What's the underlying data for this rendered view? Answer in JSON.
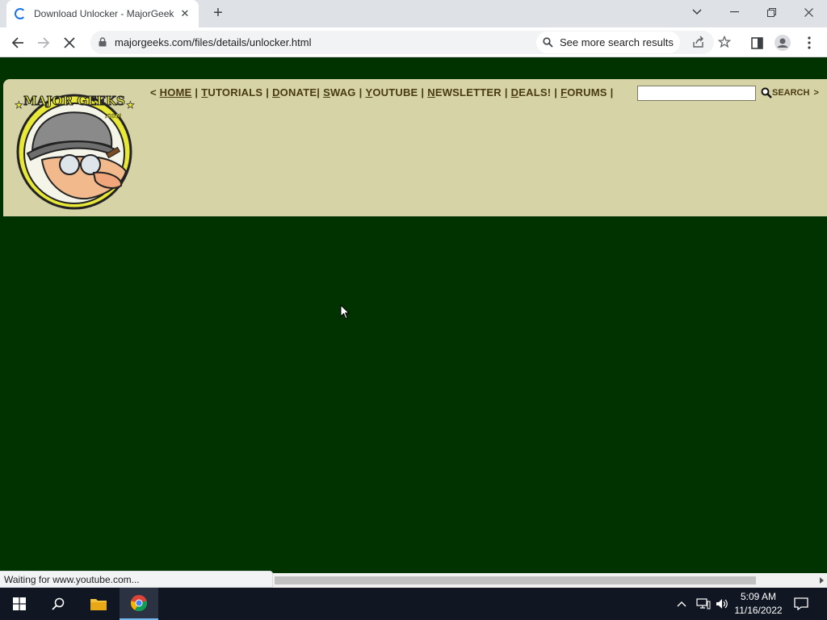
{
  "browser": {
    "tab_title": "Download Unlocker - MajorGeek",
    "tab_close": "✕",
    "new_tab": "+",
    "url": "majorgeeks.com/files/details/unlocker.html",
    "search_suggestion": "See more search results",
    "status_text": "Waiting for www.youtube.com..."
  },
  "site": {
    "logo_text": "MAJOR GEEKS",
    "logo_sub": ".COM",
    "nav_open": "<",
    "nav_close": ">",
    "nav_items": [
      {
        "first": "H",
        "rest": "OME"
      },
      {
        "first": "T",
        "rest": "UTORIALS"
      },
      {
        "first": "D",
        "rest": "ONATE"
      },
      {
        "first": "S",
        "rest": "WAG"
      },
      {
        "first": "Y",
        "rest": "OUTUBE"
      },
      {
        "first": "N",
        "rest": "EWSLETTER"
      },
      {
        "first": "D",
        "rest": "EALS!"
      },
      {
        "first": "F",
        "rest": "ORUMS"
      }
    ],
    "search_label": "SEARCH",
    "search_value": ""
  },
  "taskbar": {
    "time": "5:09 AM",
    "date": "11/16/2022"
  },
  "colors": {
    "page_bg": "#003300",
    "header_bg": "#d6d3a6",
    "nav_text": "#4a3b12",
    "logo_ring": "#e8e838"
  }
}
